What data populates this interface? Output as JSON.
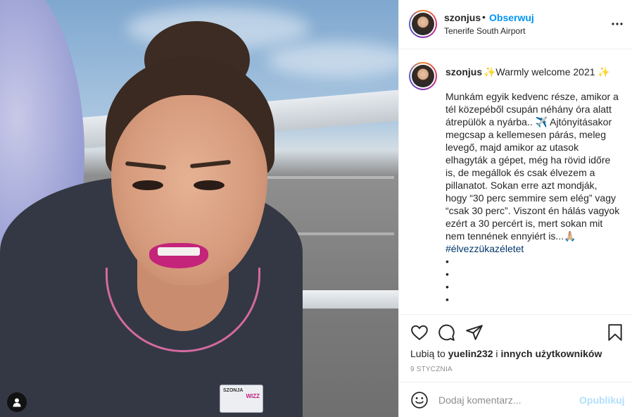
{
  "post": {
    "image_alt": "",
    "badge": {
      "name": "SZONJA",
      "role": "",
      "brand": "WIZZ"
    }
  },
  "header": {
    "username": "szonjus",
    "separator": "•",
    "follow_label": "Obserwuj",
    "location": "Tenerife South Airport",
    "more_icon": "more-horizontal-icon"
  },
  "caption": {
    "username": "szonjus",
    "title": "✨Warmly welcome 2021 ✨",
    "body": "Munkám egyik kedvenc része, amikor a tél közepéből csupán néhány óra alatt átrepülök a nyárba.. ✈️ Ajtónyitásakor megcsap a kellemesen párás, meleg levegő, majd amikor az utasok elhagyták a gépet, még ha rövid időre is, de megállok és csak élvezem a pillanatot. Sokan erre azt mondják, hogy “30 perc semmire sem elég” vagy “csak 30 perc”. Viszont én hálás vagyok ezért a 30 percért is, mert sokan mit nem tennének ennyiért is...🙏🏼 ",
    "hashtag": "#élvezzükazéletet",
    "dots": "\n•\n•\n•\n•"
  },
  "actions": {
    "icons": [
      "heart-icon",
      "comment-icon",
      "share-icon",
      "bookmark-icon"
    ],
    "likes_prefix": "Lubią to ",
    "likes_user": "yuelin232",
    "likes_mid": " i ",
    "likes_others": "innych użytkowników",
    "date": "9 STYCZNIA"
  },
  "comment": {
    "placeholder": "Dodaj komentarz...",
    "publish_label": "Opublikuj",
    "emoji_icon": "emoji-icon"
  },
  "colors": {
    "accent": "#0095f6",
    "publish_disabled": "#b2dffc",
    "lipstick": "#c4247a"
  }
}
